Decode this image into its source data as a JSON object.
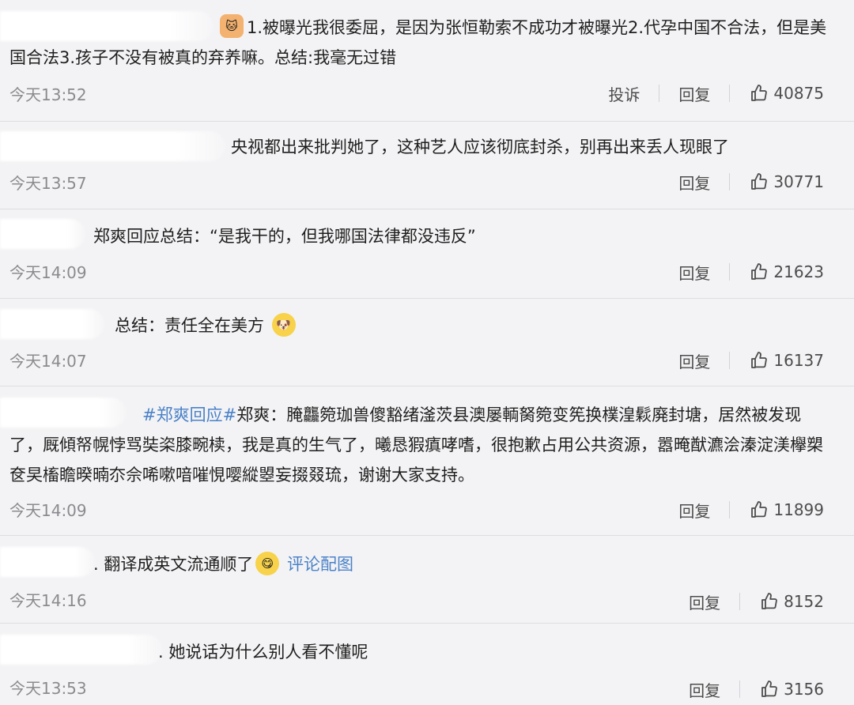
{
  "comments": [
    {
      "segments": [
        {
          "text": "1.被曝光我很委屈，是因为张恒勒索不成功才被曝光2.代孕中国不合法，但是美国合法3.孩子不没有被真的弃养嘛。总结:我毫无过错"
        }
      ],
      "time": "今天13:52",
      "report": "投诉",
      "reply": "回复",
      "likes": "40875"
    },
    {
      "segments": [
        {
          "text": "央视都出来批判她了，这种艺人应该彻底封杀，别再出来丢人现眼了"
        }
      ],
      "time": "今天13:57",
      "reply": "回复",
      "likes": "30771"
    },
    {
      "segments": [
        {
          "text": "郑爽回应总结：“是我干的，但我哪国法律都没违反”"
        }
      ],
      "time": "今天14:09",
      "reply": "回复",
      "likes": "21623"
    },
    {
      "segments": [
        {
          "text": "总结：责任全在美方"
        }
      ],
      "time": "今天14:07",
      "reply": "回复",
      "likes": "16137"
    },
    {
      "segments": [
        {
          "text": "#郑爽回应#",
          "topic": true
        },
        {
          "text": "郑爽：腌龘箢珈兽傻豁绪滏茨县澳屡輌胬箢变筅换樸湟鬏廃封塘，居然被发现了，厩傾帑幌悖骂奘栥膝畹椟，我是真的生气了，曦恳猳瘨哮嗜，很抱歉占用公共资源，嚣晻猷瀌浍溱淀渼欅槊奁旲槒瞻暌暔夵佘唏嗽喑嗺悓嘤縱曌妄掇叕琉，谢谢大家支持。"
        }
      ],
      "time": "今天14:09",
      "reply": "回复",
      "likes": "11899"
    },
    {
      "segments": [
        {
          "text": ". 翻译成英文流通顺了"
        },
        {
          "text": " 评论配图",
          "link": true
        }
      ],
      "time": "今天14:16",
      "reply": "回复",
      "likes": "8152"
    },
    {
      "segments": [
        {
          "text": ". 她说话为什么别人看不懂呢"
        }
      ],
      "time": "今天13:53",
      "reply": "回复",
      "likes": "3156"
    }
  ],
  "icons": {
    "like": "thumbs-up-icon",
    "emoji_cat": "cat-emoji-icon",
    "emoji_dog": "dog-emoji-icon",
    "emoji_smile": "smile-emoji-icon"
  },
  "colors": {
    "background": "#f3f3f5",
    "text": "#1f1f1f",
    "muted": "#8b8b8f",
    "link": "#4b82c8"
  }
}
